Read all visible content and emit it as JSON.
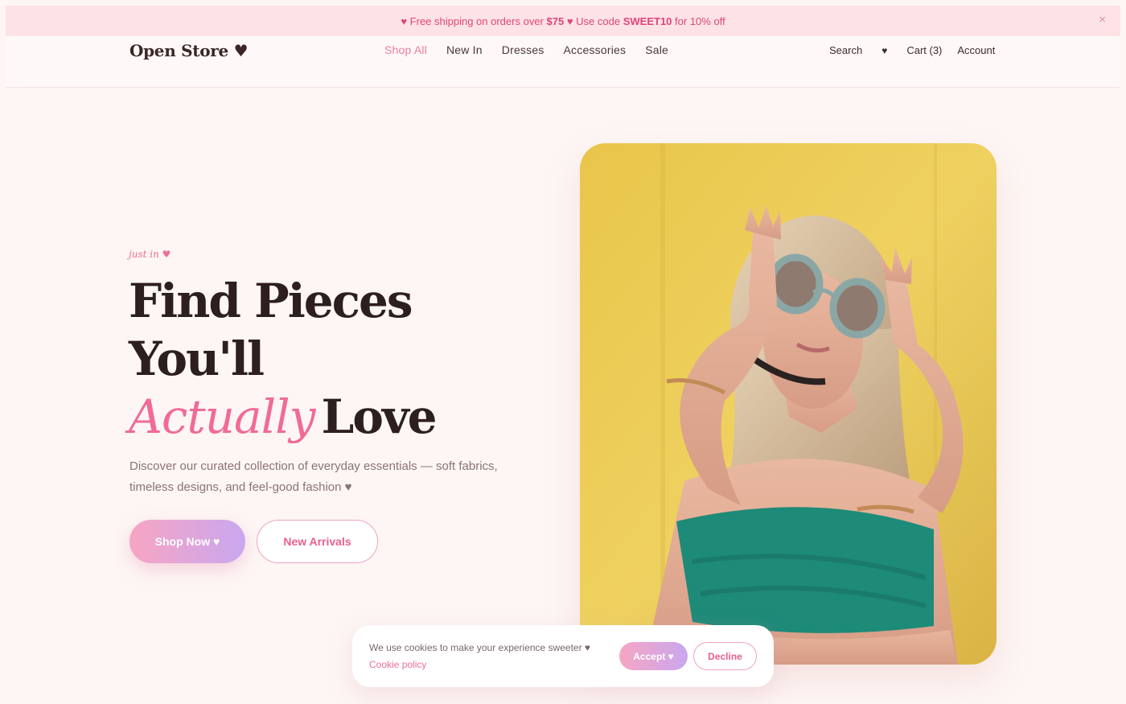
{
  "announcement": {
    "heart_left": "♥",
    "text_1": "Free shipping on orders over",
    "amount": "$75",
    "heart_mid": "♥",
    "text_2": "Use code",
    "code": "SWEET10",
    "text_3": "for 10% off",
    "close_glyph": "×"
  },
  "header": {
    "logo": "Open Store ♥",
    "nav": [
      "Shop All",
      "New In",
      "Dresses",
      "Accessories",
      "Sale"
    ],
    "active_nav": "Shop All",
    "search_label": "Search",
    "wishlist_glyph": "♥",
    "cart_label": "Cart (3)",
    "account_label": "Account"
  },
  "hero": {
    "eyebrow": "just in ♥",
    "headline_line1": "Find Pieces",
    "headline_line2": "You'll",
    "headline_script": "Actually",
    "headline_end": "Love",
    "description": "Discover our curated collection of everyday essentials — soft fabrics, timeless designs, and feel-good fashion ♥",
    "primary_button": "Shop Now ♥",
    "secondary_button": "New Arrivals"
  },
  "cookie": {
    "message": "We use cookies to make your experience sweeter ♥",
    "policy_link": "Cookie policy",
    "accept": "Accept ♥",
    "decline": "Decline"
  },
  "colors": {
    "accent_pink": "#ec6f97",
    "background": "#fdf6f4",
    "announcement_bg": "#fde2e6",
    "headline": "#2e1f1f",
    "gradient_start": "#f7a5c2",
    "gradient_end": "#c9a7f0"
  }
}
